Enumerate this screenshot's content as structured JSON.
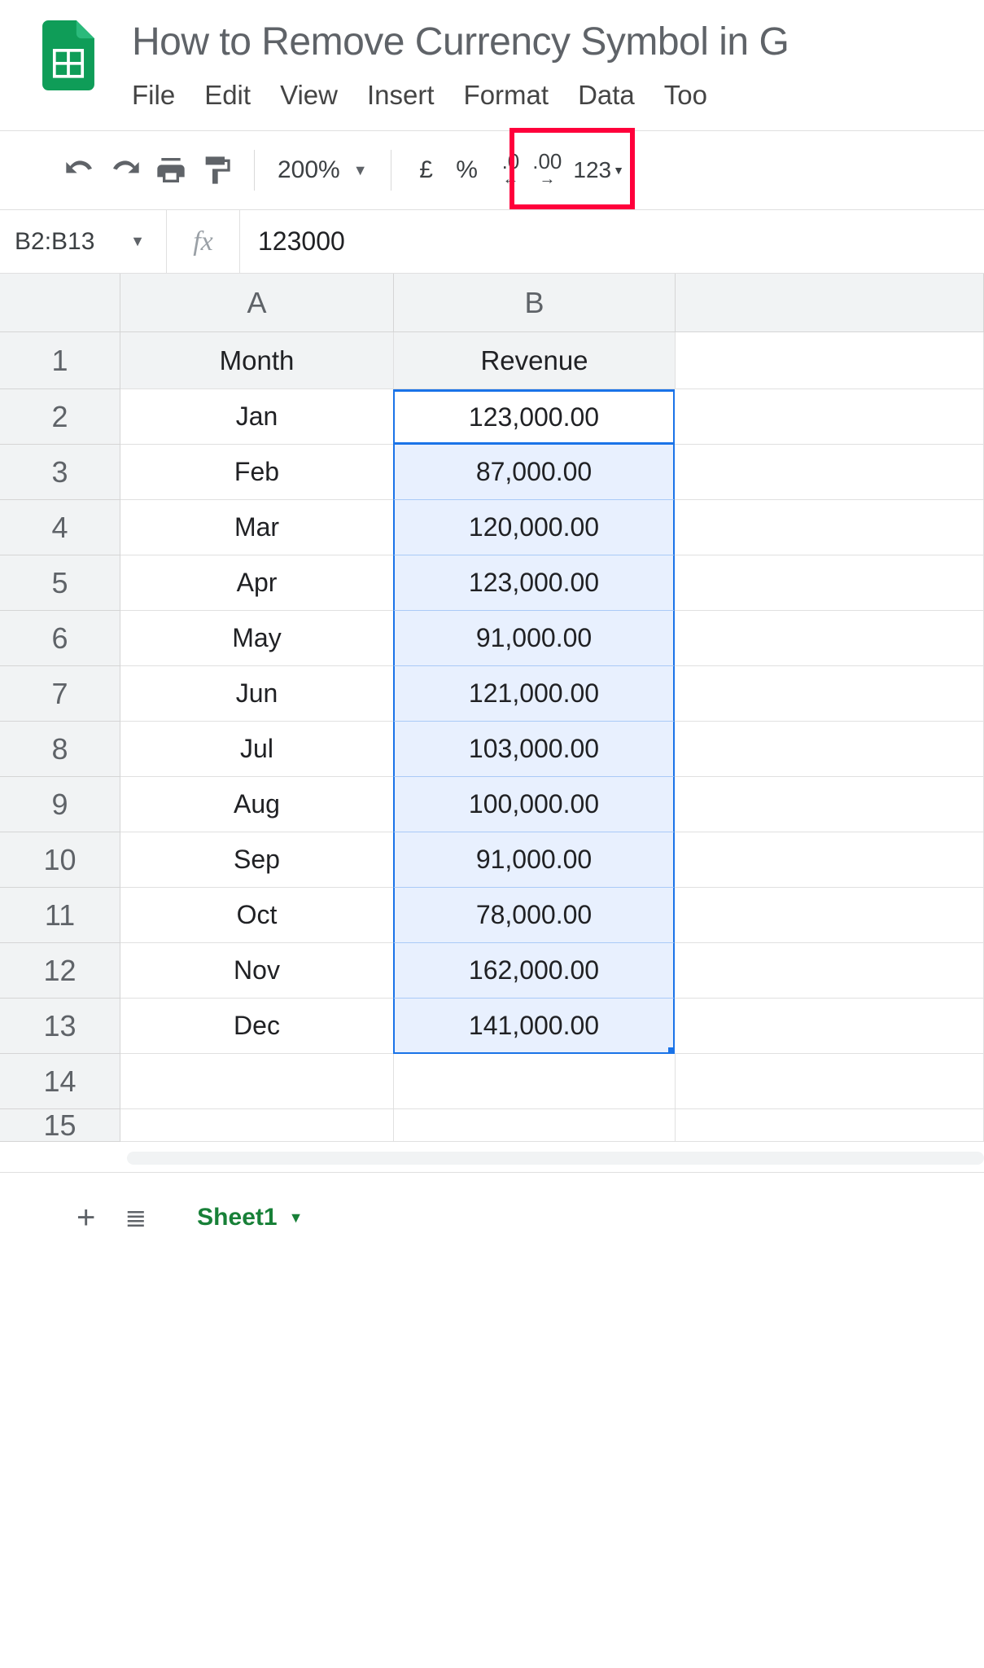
{
  "doc_title": "How to Remove Currency Symbol in G",
  "menubar": [
    "File",
    "Edit",
    "View",
    "Insert",
    "Format",
    "Data",
    "Too"
  ],
  "toolbar": {
    "zoom": "200%",
    "currency_symbol": "£",
    "percent": "%",
    "dec_decrease": ".0",
    "dec_increase": ".00",
    "more_formats": "123"
  },
  "namebox": "B2:B13",
  "fx_label": "fx",
  "formula_value": "123000",
  "columns": [
    "A",
    "B"
  ],
  "headers": {
    "A": "Month",
    "B": "Revenue"
  },
  "rows": [
    {
      "n": "1",
      "A": "Month",
      "B": "Revenue",
      "header": true
    },
    {
      "n": "2",
      "A": "Jan",
      "B": "123,000.00"
    },
    {
      "n": "3",
      "A": "Feb",
      "B": "87,000.00"
    },
    {
      "n": "4",
      "A": "Mar",
      "B": "120,000.00"
    },
    {
      "n": "5",
      "A": "Apr",
      "B": "123,000.00"
    },
    {
      "n": "6",
      "A": "May",
      "B": "91,000.00"
    },
    {
      "n": "7",
      "A": "Jun",
      "B": "121,000.00"
    },
    {
      "n": "8",
      "A": "Jul",
      "B": "103,000.00"
    },
    {
      "n": "9",
      "A": "Aug",
      "B": "100,000.00"
    },
    {
      "n": "10",
      "A": "Sep",
      "B": "91,000.00"
    },
    {
      "n": "11",
      "A": "Oct",
      "B": "78,000.00"
    },
    {
      "n": "12",
      "A": "Nov",
      "B": "162,000.00"
    },
    {
      "n": "13",
      "A": "Dec",
      "B": "141,000.00"
    },
    {
      "n": "14",
      "A": "",
      "B": ""
    },
    {
      "n": "15",
      "A": "",
      "B": ""
    }
  ],
  "selection": {
    "col": "B",
    "start": 2,
    "end": 13
  },
  "sheet_tabs": {
    "add": "+",
    "all": "≣",
    "active": "Sheet1"
  }
}
